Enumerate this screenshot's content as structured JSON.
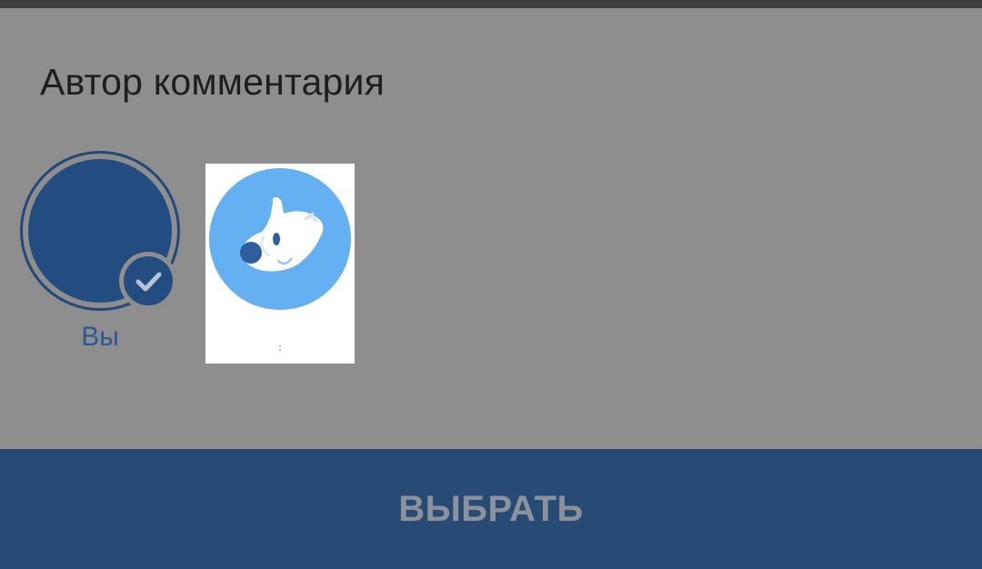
{
  "dialog": {
    "title": "Автор комментария"
  },
  "authors": [
    {
      "label": "Вы",
      "selected": true,
      "icon": "checkmark-icon"
    },
    {
      "label": ":",
      "selected": false,
      "icon": "dog-mascot-icon"
    }
  ],
  "footer": {
    "select_label": "ВЫБРАТЬ"
  },
  "colors": {
    "overlay": "#8e8e8e",
    "accent": "#234d80",
    "footer": "#274b74",
    "group_avatar": "#64b0f3"
  }
}
